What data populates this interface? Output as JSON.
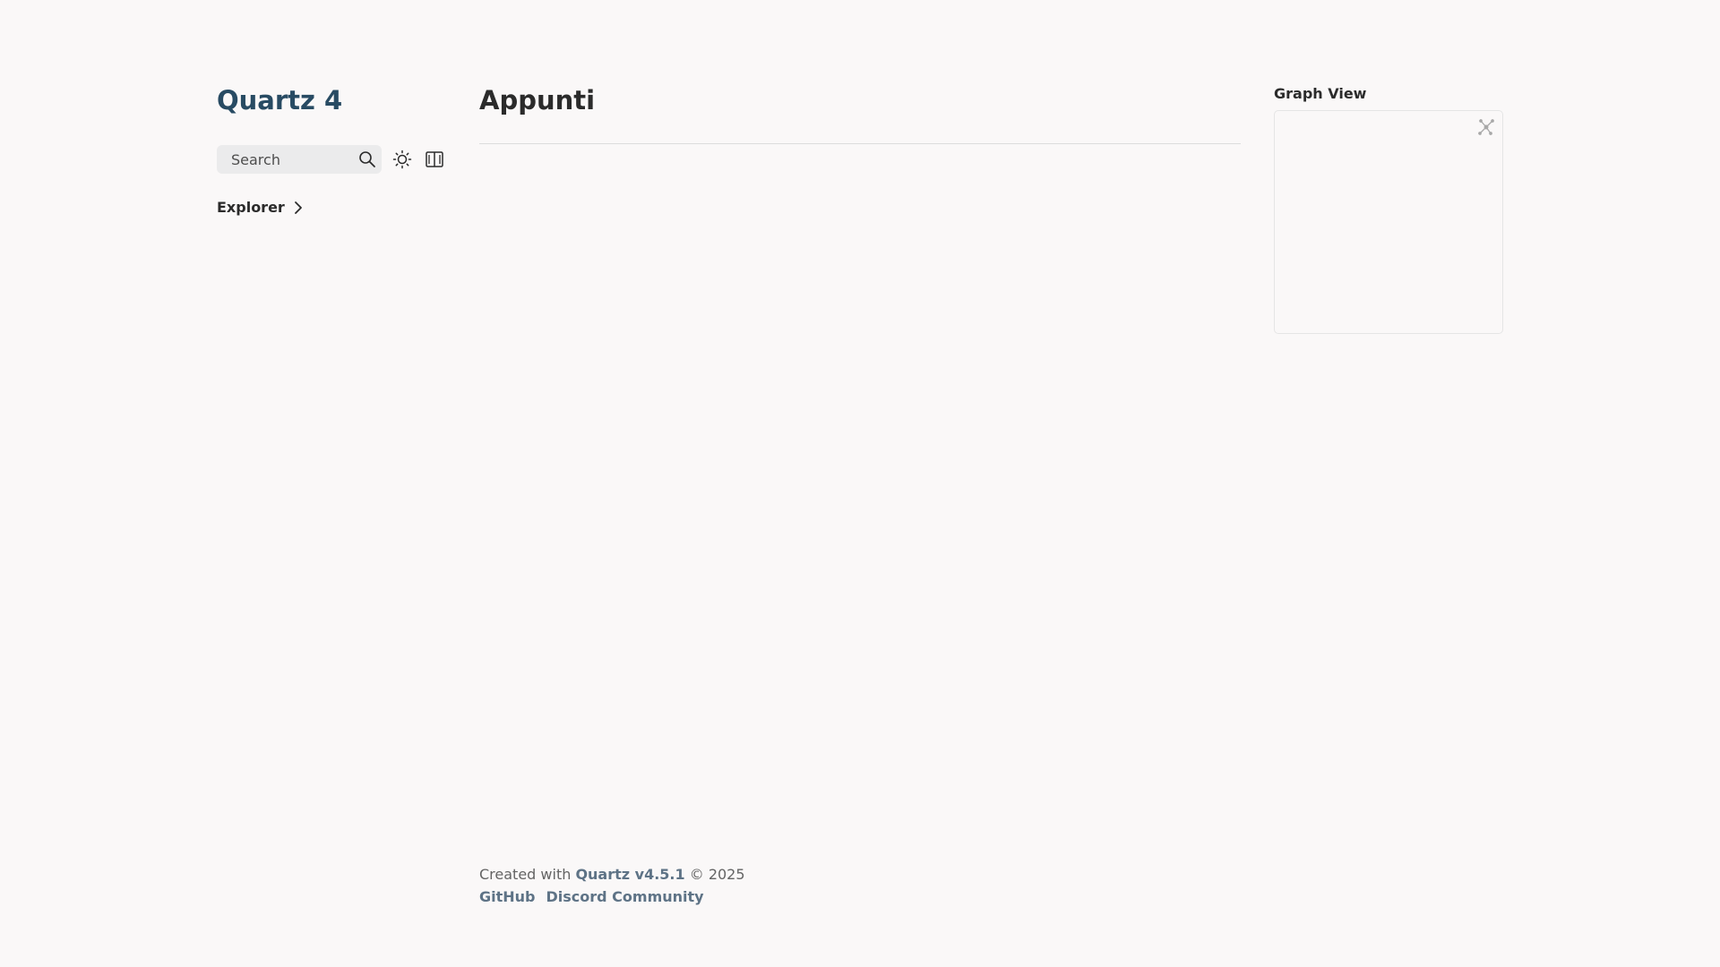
{
  "sidebar": {
    "site_title": "Quartz 4",
    "search_placeholder": "Search",
    "explorer_title": "Explorer"
  },
  "main": {
    "title": "Appunti"
  },
  "graph": {
    "title": "Graph View"
  },
  "footer": {
    "created_prefix": "Created with ",
    "quartz_link": "Quartz v4.5.1",
    "copyright": " © 2025",
    "links": [
      "GitHub",
      "Discord Community"
    ]
  },
  "icons": {
    "search": "search-icon",
    "theme": "sun-icon",
    "reader": "book-icon",
    "explorer_toggle": "chevron-right-icon",
    "graph_expand": "global-graph-icon"
  },
  "colors": {
    "background": "#faf8f8",
    "accent": "#284b63",
    "link": "#5e7386",
    "text": "#2b2b2b"
  }
}
